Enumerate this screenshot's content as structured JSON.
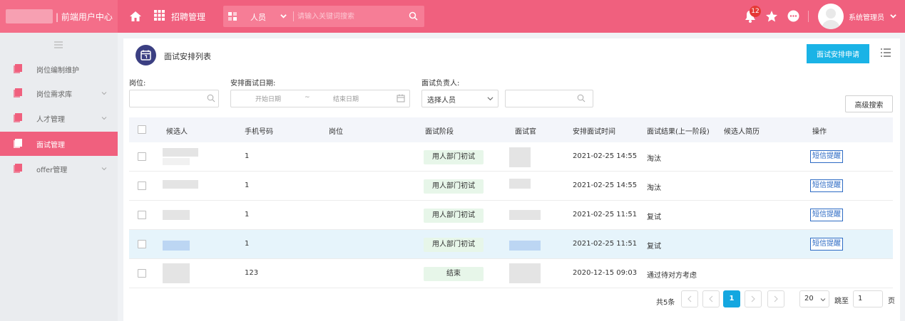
{
  "header": {
    "app_title": "| 前端用户中心",
    "module": "招聘管理",
    "search_category": "人员",
    "search_placeholder": "请输入关键词搜索",
    "notification_count": "12",
    "username": "系统管理员"
  },
  "sidebar": {
    "items": [
      {
        "label": "岗位编制维护",
        "has_children": false,
        "active": false
      },
      {
        "label": "岗位需求库",
        "has_children": true,
        "active": false
      },
      {
        "label": "人才管理",
        "has_children": true,
        "active": false
      },
      {
        "label": "面试管理",
        "has_children": false,
        "active": true
      },
      {
        "label": "offer管理",
        "has_children": true,
        "active": false
      }
    ]
  },
  "page": {
    "title": "面试安排列表",
    "apply_button": "面试安排申请"
  },
  "filters": {
    "position_label": "岗位:",
    "date_label": "安排面试日期:",
    "start_placeholder": "开始日期",
    "date_separator": "~",
    "end_placeholder": "结束日期",
    "owner_label": "面试负责人:",
    "owner_select": "选择人员",
    "advanced_search": "高级搜索"
  },
  "table": {
    "columns": [
      "候选人",
      "手机号码",
      "岗位",
      "面试阶段",
      "面试官",
      "安排面试时间",
      "面试结果(上一阶段)",
      "候选人简历",
      "操作"
    ],
    "rows": [
      {
        "phone": "1",
        "stage": "用人部门初试",
        "time": "2021-02-25 14:55",
        "result": "淘汰",
        "action": "短信提醒",
        "highlight": false
      },
      {
        "phone": "1",
        "stage": "用人部门初试",
        "time": "2021-02-25 14:55",
        "result": "淘汰",
        "action": "短信提醒",
        "highlight": false
      },
      {
        "phone": "1",
        "stage": "用人部门初试",
        "time": "2021-02-25 11:51",
        "result": "复试",
        "action": "短信提醒",
        "highlight": false
      },
      {
        "phone": "1",
        "stage": "用人部门初试",
        "time": "2021-02-25 11:51",
        "result": "复试",
        "action": "短信提醒",
        "highlight": true
      },
      {
        "phone": "123",
        "stage": "结束",
        "time": "2020-12-15 09:03",
        "result": "通过待对方考虑",
        "action": "",
        "highlight": false
      }
    ]
  },
  "pagination": {
    "total": "共5条",
    "current_page": "1",
    "page_size": "20",
    "goto_label": "跳至",
    "goto_value": "1",
    "page_suffix": "页"
  },
  "colors": {
    "brand": "#f0607e",
    "primary_button": "#1ab3e6",
    "sms_link": "#2d6bc4",
    "stage_bg": "#e7f6e9",
    "badge": "#e53935"
  },
  "icons": [
    "home-icon",
    "grid-icon",
    "search-icon",
    "bell-icon",
    "star-icon",
    "more-icon",
    "calendar-icon",
    "list-icon",
    "chevron-down-icon"
  ]
}
